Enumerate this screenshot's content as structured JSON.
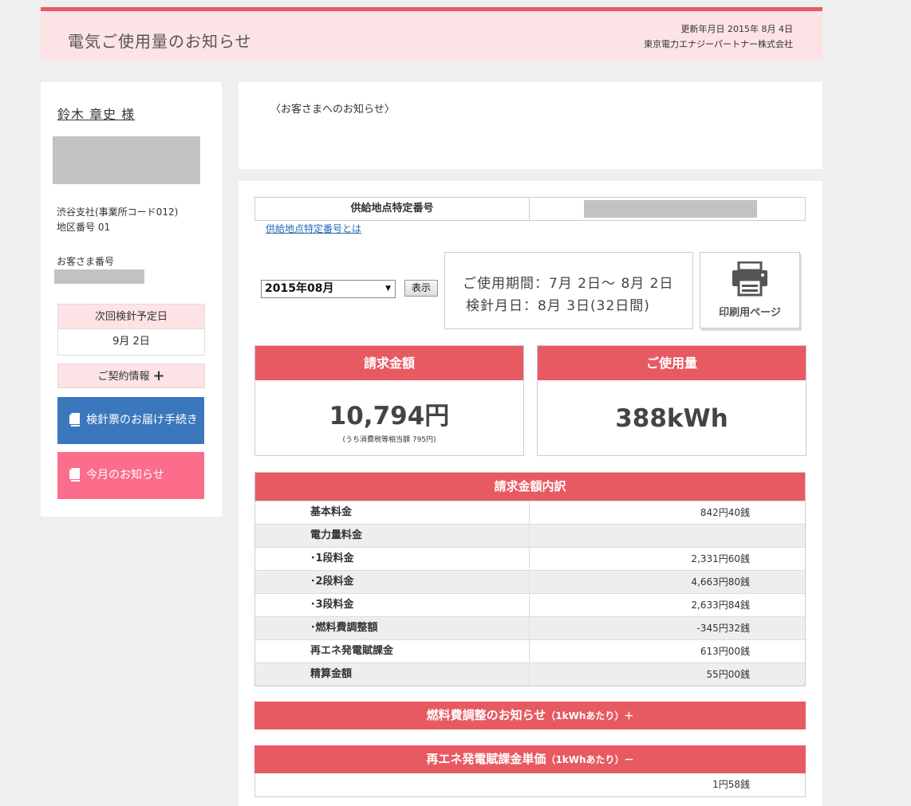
{
  "header": {
    "title": "電気ご使用量のお知らせ",
    "updated": "更新年月日 2015年 8月 4日",
    "company": "東京電力エナジーパートナー株式会社"
  },
  "sidebar": {
    "customer_name": "鈴木 章史 様",
    "branch": "渋谷支社(事業所コード012)",
    "area": "地区番号 01",
    "customer_no_label": "お客さま番号",
    "next_reading_label": "次回検針予定日",
    "next_reading_date": "9月 2日",
    "contract_label": "ご契約情報",
    "contract_icon": "plus-icon",
    "btn_meter": "検針票のお届け手続き",
    "btn_notice": "今月のお知らせ",
    "btn_meter_color": "#3a77bd",
    "btn_notice_color": "#fb6d8a"
  },
  "notice": {
    "title": "〈お客さまへのお知らせ〉"
  },
  "main": {
    "supply_label": "供給地点特定番号",
    "supply_link": "供給地点特定番号とは",
    "month_select": "2015年08月",
    "show_button": "表示",
    "period_line1": "ご使用期間：7月 2日〜 8月 2日",
    "period_line2": "検針月日：8月 3日(32日間)",
    "print_label": "印刷用ページ",
    "bill_header": "請求金額",
    "bill_amount": "10,794円",
    "bill_tax": "(うち消費税等相当額 795円)",
    "usage_header": "ご使用量",
    "usage_amount": "388kWh",
    "accent_color": "#e85a62",
    "detail_header": "請求金額内訳",
    "detail_rows": [
      {
        "label": "基本料金",
        "value": "842円40銭"
      },
      {
        "label": "電力量料金",
        "value": ""
      },
      {
        "label": "･1段料金",
        "value": "2,331円60銭"
      },
      {
        "label": "･2段料金",
        "value": "4,663円80銭"
      },
      {
        "label": "･3段料金",
        "value": "2,633円84銭"
      },
      {
        "label": "･燃料費調整額",
        "value": "-345円32銭"
      },
      {
        "label": "再エネ発電賦課金",
        "value": "613円00銭"
      },
      {
        "label": "精算金額",
        "value": "55円00銭"
      }
    ],
    "fuel_bar": "燃料費調整のお知らせ",
    "fuel_bar_unit": "（1kWhあたり）＋",
    "renew_bar": "再エネ発電賦課金単価",
    "renew_bar_unit": "（1kWhあたり）－",
    "renew_value": "1円58銭"
  }
}
